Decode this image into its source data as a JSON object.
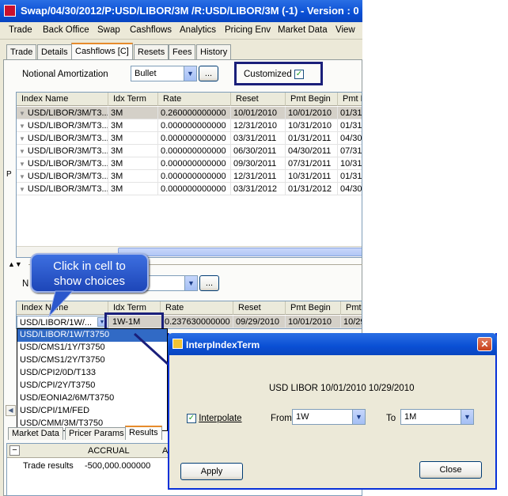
{
  "window": {
    "title": "Swap/04/30/2012/P:USD/LIBOR/3M /R:USD/LIBOR/3M  (-1) - Version : 0"
  },
  "menu": [
    "Trade",
    "Back Office",
    "Swap",
    "Cashflows",
    "Analytics",
    "Pricing Env",
    "Market Data",
    "View"
  ],
  "tabs": [
    "Trade",
    "Details",
    "Cashflows [C]",
    "Resets",
    "Fees",
    "History"
  ],
  "top_section": {
    "notional_label": "Notional Amortization",
    "amortization_value": "Bullet",
    "ellipsis": "...",
    "customized_label": "Customized",
    "customized_checked": "✓",
    "side_letter": "P"
  },
  "grid1": {
    "columns": [
      "Index Name",
      "Idx Term",
      "Rate",
      "Reset",
      "Pmt Begin",
      "Pmt E"
    ],
    "rows": [
      [
        "USD/LIBOR/3M/T3...",
        "3M",
        "0.260000000000",
        "10/01/2010",
        "10/01/2010",
        "01/31,"
      ],
      [
        "USD/LIBOR/3M/T3...",
        "3M",
        "0.000000000000",
        "12/31/2010",
        "10/31/2010",
        "01/31,"
      ],
      [
        "USD/LIBOR/3M/T3...",
        "3M",
        "0.000000000000",
        "03/31/2011",
        "01/31/2011",
        "04/30,"
      ],
      [
        "USD/LIBOR/3M/T3...",
        "3M",
        "0.000000000000",
        "06/30/2011",
        "04/30/2011",
        "07/31,"
      ],
      [
        "USD/LIBOR/3M/T3...",
        "3M",
        "0.000000000000",
        "09/30/2011",
        "07/31/2011",
        "10/31,"
      ],
      [
        "USD/LIBOR/3M/T3...",
        "3M",
        "0.000000000000",
        "12/31/2011",
        "10/31/2011",
        "01/31,"
      ],
      [
        "USD/LIBOR/3M/T3...",
        "3M",
        "0.000000000000",
        "03/31/2012",
        "01/31/2012",
        "04/30,"
      ]
    ]
  },
  "lower_section": {
    "notional_letter": "N",
    "amortization_value": "et",
    "ellipsis": "..."
  },
  "grid2": {
    "columns": [
      "Index Name",
      "Idx Term",
      "Rate",
      "Reset",
      "Pmt Begin",
      "Pmt"
    ],
    "row": [
      "USD/LIBOR/1W/...",
      "1W-1M",
      "0.237630000000",
      "09/29/2010",
      "10/01/2010",
      "10/29/"
    ]
  },
  "callout": {
    "line1": "Click in cell to",
    "line2": "show choices"
  },
  "dropdown_options": [
    "USD/LIBOR/1W/T3750",
    "USD/CMS1/1Y/T3750",
    "USD/CMS1/2Y/T3750",
    "USD/CPI2/0D/T133",
    "USD/CPI/2Y/T3750",
    "USD/EONIA2/6M/T3750",
    "USD/CPI/1M/FED",
    "USD/CMM/3M/T3750"
  ],
  "bottom_tabs": [
    "Market Data",
    "Pricer Params",
    "Results"
  ],
  "results": {
    "minus": "−",
    "col1": "ACCRUAL",
    "col2": "A",
    "row_label": "Trade results",
    "row_value": "-500,000.000000"
  },
  "dialog": {
    "title": "InterpIndexTerm",
    "info": "USD LIBOR 10/01/2010 10/29/2010",
    "interpolate_label": "Interpolate",
    "interpolate_checked": "✓",
    "from_label": "From",
    "from_value": "1W",
    "to_label": "To",
    "to_value": "1M",
    "apply": "Apply",
    "close": "Close"
  },
  "colors": {
    "title_blue": "#0a4fd4",
    "highlight": "#316ac5",
    "frame": "#1a1f7a"
  }
}
